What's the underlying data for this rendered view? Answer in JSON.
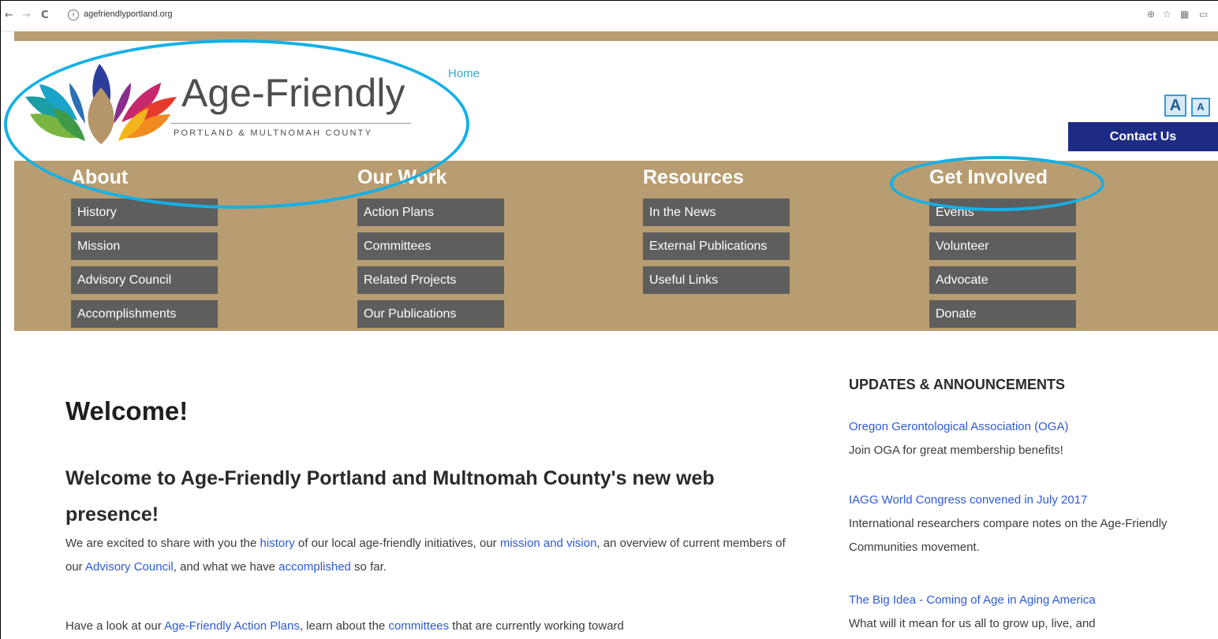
{
  "browser": {
    "back": "←",
    "forward": "→",
    "reload": "C",
    "info": "i",
    "url": "agefriendlyportland.org",
    "zoom_icon": "⊕",
    "star_icon": "☆",
    "ext1_icon": "▦",
    "ext2_icon": "▭"
  },
  "logo": {
    "title": "Age-Friendly",
    "subtitle": "PORTLAND & MULTNOMAH COUNTY"
  },
  "header": {
    "home_label": "Home",
    "font_large": "A",
    "font_small": "A",
    "contact_label": "Contact Us"
  },
  "nav": [
    {
      "heading": "About",
      "items": [
        "History",
        "Mission",
        "Advisory Council",
        "Accomplishments"
      ]
    },
    {
      "heading": "Our Work",
      "items": [
        "Action Plans",
        "Committees",
        "Related Projects",
        "Our Publications"
      ]
    },
    {
      "heading": "Resources",
      "items": [
        "In the News",
        "External Publications",
        "Useful Links"
      ]
    },
    {
      "heading": "Get Involved",
      "items": [
        "Events",
        "Volunteer",
        "Advocate",
        "Donate"
      ]
    }
  ],
  "main": {
    "title": "Welcome!",
    "subheading": "Welcome to Age-Friendly Portland and Multnomah County's new web presence!",
    "p1": {
      "t1": "We are excited to share with you the ",
      "l1": "history",
      "t2": " of our local age-friendly initiatives, our ",
      "l2": "mission and vision",
      "t3": ", an overview of current members of our ",
      "l3": "Advisory Council",
      "t4": ", and what we have ",
      "l4": "accomplished",
      "t5": " so far."
    },
    "p2": {
      "t1": "Have a look at our ",
      "l1": "Age-Friendly Action Plans",
      "t2": ", learn about the ",
      "l2": "committees",
      "t3": " that are currently working toward"
    }
  },
  "sidebar": {
    "title": "UPDATES & ANNOUNCEMENTS",
    "items": [
      {
        "link": "Oregon Gerontological Association (OGA)",
        "text": "Join OGA for great membership benefits!"
      },
      {
        "link": "IAGG World Congress convened in July 2017",
        "text": "International researchers compare notes on the Age-Friendly Communities movement."
      },
      {
        "link": "The Big Idea - Coming of Age in Aging America",
        "text": "What will it mean for us all to grow up, live, and"
      }
    ]
  },
  "colors": {
    "band": "#b79d71",
    "nav_item": "#5e5e5e",
    "contact": "#1e2b84",
    "link": "#2e5ad7",
    "annotation": "#14b0e6"
  }
}
